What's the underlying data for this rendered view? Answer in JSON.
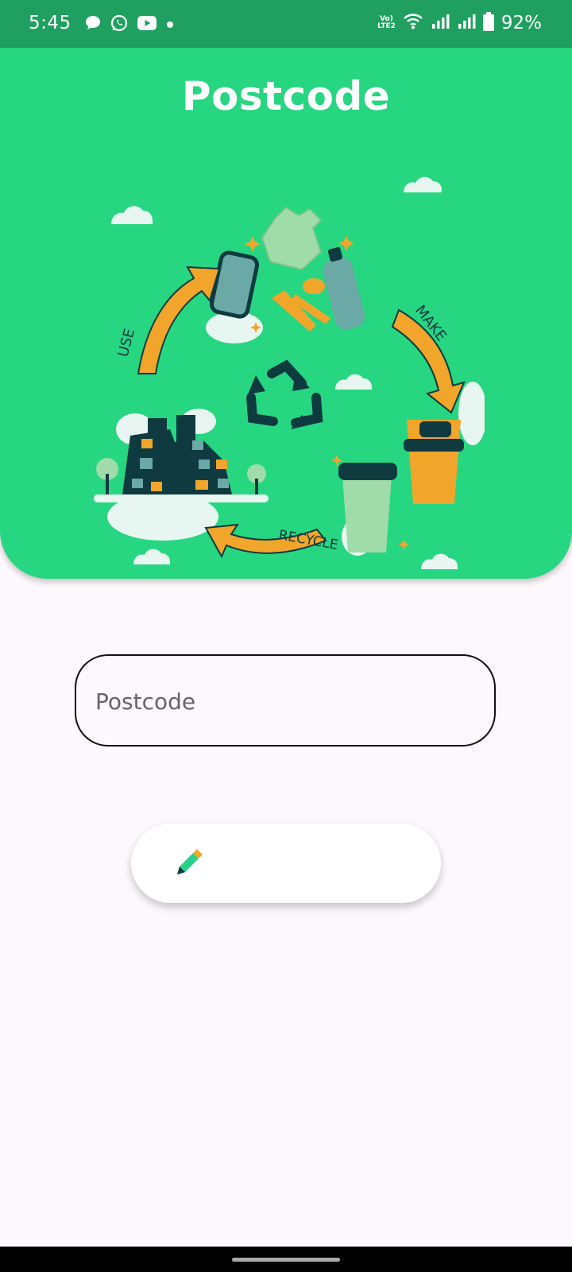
{
  "status_bar": {
    "time": "5:45",
    "notification_icons": [
      "chat-bubble-icon",
      "whatsapp-icon",
      "youtube-icon",
      "dot-icon"
    ],
    "volte_label_top": "Vo)",
    "volte_label_bottom": "LTE2",
    "battery_percent": "92%"
  },
  "header": {
    "title": "Postcode",
    "illustration_labels": {
      "use": "USE",
      "make": "MAKE",
      "recycle": "RECYCLE"
    }
  },
  "form": {
    "postcode_placeholder": "Postcode",
    "postcode_value": ""
  },
  "action_button": {
    "icon": "pencil-icon",
    "label": ""
  },
  "colors": {
    "status_bar": "#1fa060",
    "header": "#27d681",
    "background": "#fdf8fc",
    "accent_orange": "#f2a52b",
    "dark_teal": "#0f3a40"
  }
}
